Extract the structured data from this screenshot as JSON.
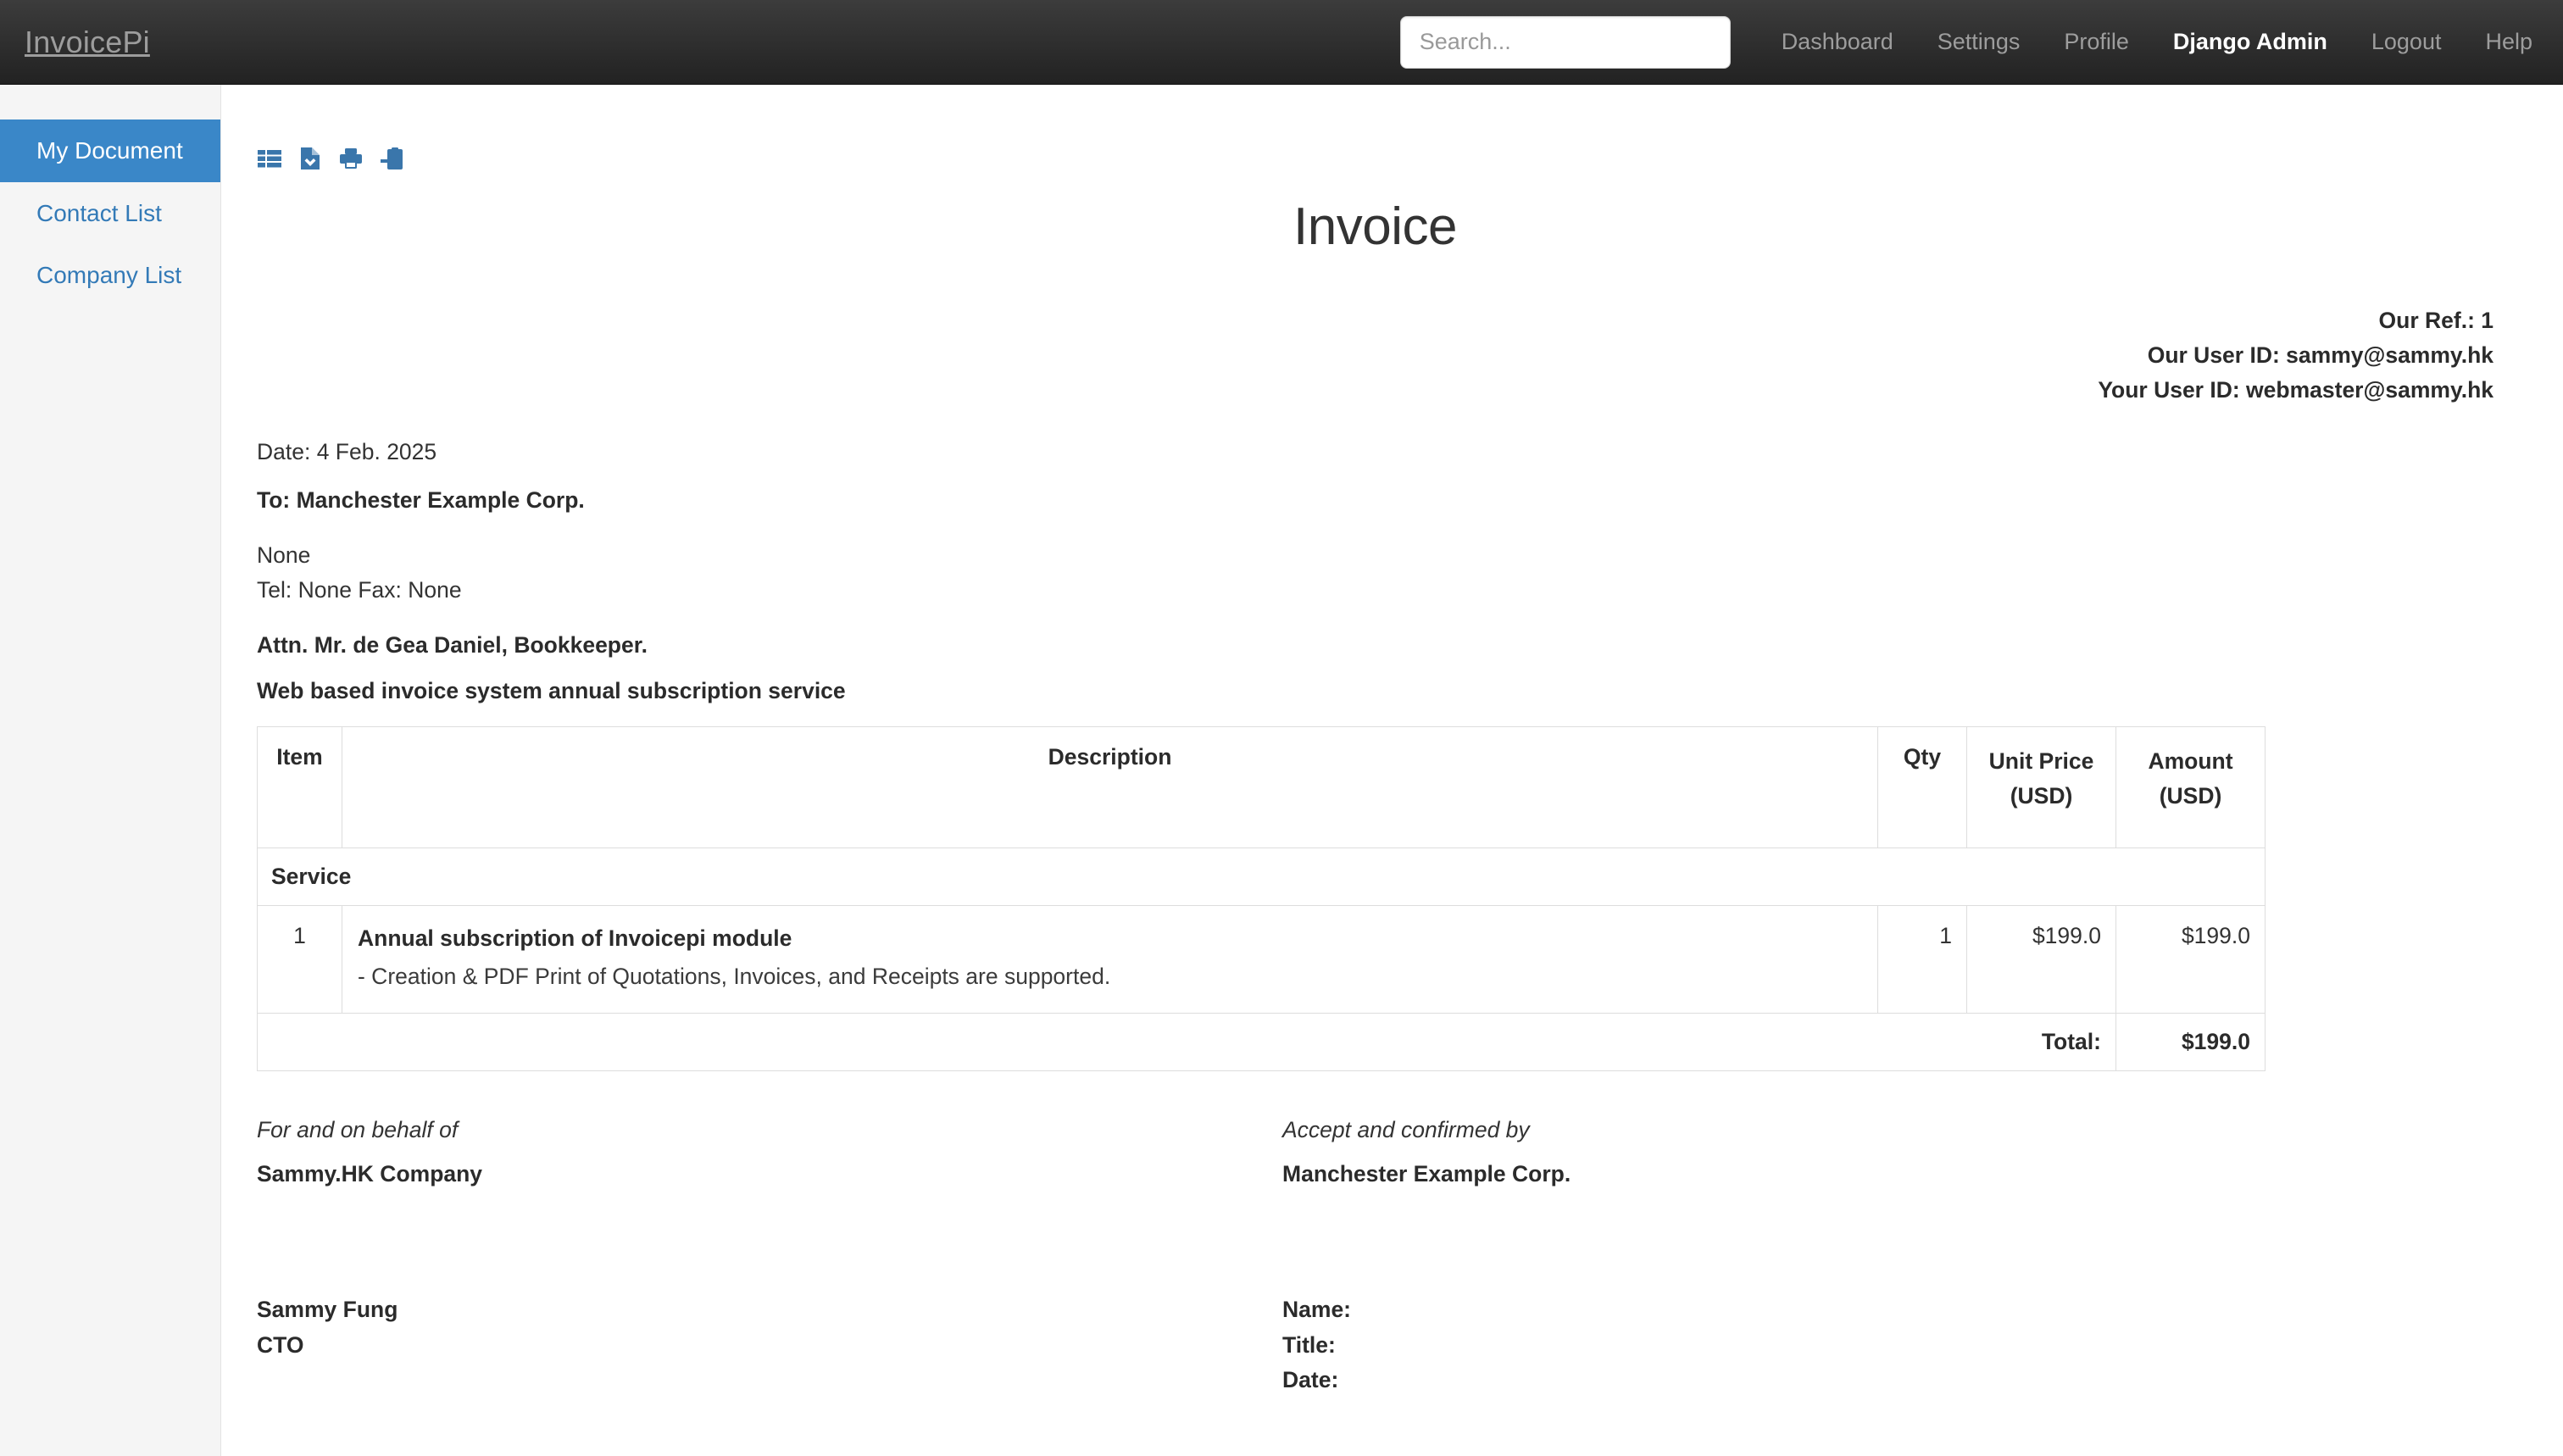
{
  "navbar": {
    "brand": "InvoicePi",
    "search": {
      "placeholder": "Search...",
      "value": ""
    },
    "links": [
      {
        "label": "Dashboard",
        "active": false
      },
      {
        "label": "Settings",
        "active": false
      },
      {
        "label": "Profile",
        "active": false
      },
      {
        "label": "Django Admin",
        "active": true
      },
      {
        "label": "Logout",
        "active": false
      },
      {
        "label": "Help",
        "active": false
      }
    ]
  },
  "sidebar": {
    "items": [
      {
        "label": "My Document",
        "active": true
      },
      {
        "label": "Contact List",
        "active": false
      },
      {
        "label": "Company List",
        "active": false
      }
    ]
  },
  "toolbar": {
    "icons": [
      {
        "name": "list-icon",
        "title": "List"
      },
      {
        "name": "file-download-icon",
        "title": "Download"
      },
      {
        "name": "print-icon",
        "title": "Print"
      },
      {
        "name": "clipboard-arrow-icon",
        "title": "Copy to clipboard"
      }
    ]
  },
  "document": {
    "title": "Invoice",
    "our_ref": "Our Ref.: 1",
    "our_user_id": "Our User ID: sammy@sammy.hk",
    "your_user_id": "Your User ID: webmaster@sammy.hk",
    "date": "Date: 4 Feb. 2025",
    "to": "To: Manchester Example Corp.",
    "address": "None",
    "tel_fax": "Tel: None   Fax: None",
    "attn": "Attn. Mr. de Gea Daniel, Bookkeeper.",
    "subject": "Web based invoice system annual subscription service",
    "table": {
      "headers": {
        "item": "Item",
        "description": "Description",
        "qty": "Qty",
        "unit_price": "Unit Price",
        "unit_price_currency": "(USD)",
        "amount": "Amount",
        "amount_currency": "(USD)"
      },
      "group_label": "Service",
      "rows": [
        {
          "item": "1",
          "desc_title": "Annual subscription of Invoicepi module",
          "desc_sub": "- Creation & PDF Print of Quotations, Invoices, and Receipts are supported.",
          "qty": "1",
          "unit_price": "$199.0",
          "amount": "$199.0"
        }
      ],
      "total_label": "Total:",
      "total_value": "$199.0"
    },
    "signature": {
      "left_intro": "For and on behalf of",
      "left_company": "Sammy.HK Company",
      "right_intro": "Accept and confirmed by",
      "right_company": "Manchester Example Corp.",
      "left_name": "Sammy Fung",
      "left_title": "CTO",
      "right_name_label": "Name:",
      "right_title_label": "Title:",
      "right_date_label": "Date:"
    }
  },
  "colors": {
    "navbar_top": "#3c3c3c",
    "navbar_bottom": "#222222",
    "sidebar_bg": "#f5f5f5",
    "sidebar_active": "#3a87c8",
    "link_blue": "#337ab7",
    "icon_blue": "#3a76ab",
    "table_border": "#dddddd",
    "text": "#333333"
  }
}
